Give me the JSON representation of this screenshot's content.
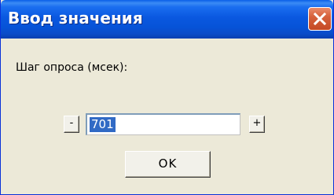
{
  "window": {
    "title": "Ввод значения"
  },
  "dialog": {
    "prompt_label": "Шаг опроса (мсек):",
    "decrement_label": "-",
    "value": "701",
    "increment_label": "+",
    "ok_label": "OK"
  },
  "icons": {
    "close": "close-icon"
  },
  "colors": {
    "titlebar": "#0a58e0",
    "close_button": "#d6613c",
    "window_background": "#ece9d8",
    "selection": "#316ac5"
  }
}
